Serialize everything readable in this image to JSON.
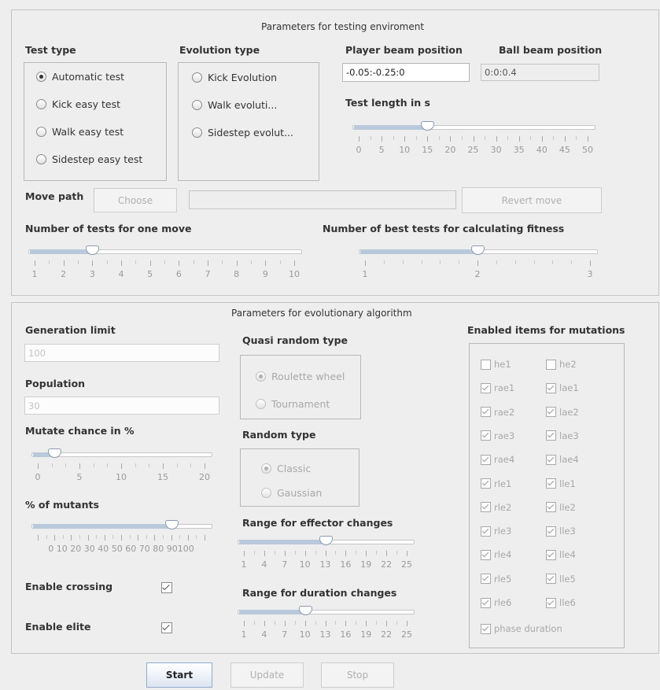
{
  "testing": {
    "title": "Parameters for testing enviroment",
    "test_type": {
      "label": "Test type",
      "options": [
        "Automatic test",
        "Kick easy test",
        "Walk easy test",
        "Sidestep easy test"
      ],
      "selected": "Automatic test"
    },
    "evolution_type": {
      "label": "Evolution type",
      "options": [
        "Kick Evolution",
        "Walk evoluti...",
        "Sidestep evolut..."
      ],
      "selected": ""
    },
    "player_beam": {
      "label": "Player beam position",
      "value": "-0.05:-0.25:0"
    },
    "ball_beam": {
      "label": "Ball beam position",
      "value": "0:0:0.4"
    },
    "test_length": {
      "label": "Test length in s",
      "value": 15,
      "min": 0,
      "max": 50,
      "ticks": [
        "0",
        "5",
        "10",
        "15",
        "20",
        "25",
        "30",
        "35",
        "40",
        "45",
        "50"
      ]
    },
    "move_path": {
      "label": "Move path",
      "choose_label": "Choose",
      "path_value": "",
      "revert_label": "Revert move"
    },
    "tests_per_move": {
      "label": "Number of tests for one move",
      "value": 3,
      "min": 1,
      "max": 10,
      "ticks": [
        "1",
        "2",
        "3",
        "4",
        "5",
        "6",
        "7",
        "8",
        "9",
        "10"
      ]
    },
    "best_tests": {
      "label": "Number of best tests for calculating fitness",
      "value": 2,
      "min": 1,
      "max": 3,
      "ticks": [
        "1",
        "2",
        "3"
      ]
    }
  },
  "evolution": {
    "title": "Parameters for evolutionary algorithm",
    "generation_limit": {
      "label": "Generation limit",
      "value": "100"
    },
    "population": {
      "label": "Population",
      "value": "30"
    },
    "mutate_chance": {
      "label": "Mutate chance in %",
      "value": 2,
      "min": 0,
      "max": 20,
      "ticks": [
        "0",
        "5",
        "10",
        "15",
        "20"
      ]
    },
    "pct_mutants": {
      "label": "% of mutants",
      "value": 80,
      "min": 0,
      "max": 100,
      "ticks_text": "0 10 20 30 40 50 60 70 80 90100"
    },
    "enable_crossing": {
      "label": "Enable crossing",
      "checked": true
    },
    "enable_elite": {
      "label": "Enable elite",
      "checked": true
    },
    "quasi_random": {
      "label": "Quasi random type",
      "options": [
        "Roulette wheel",
        "Tournament"
      ],
      "selected": "Roulette wheel"
    },
    "random_type": {
      "label": "Random type",
      "options": [
        "Classic",
        "Gaussian"
      ],
      "selected": "Classic"
    },
    "effector_range": {
      "label": "Range for effector changes",
      "value": 13,
      "min": 1,
      "max": 25,
      "ticks": [
        "1",
        "4",
        "7",
        "10",
        "13",
        "16",
        "19",
        "22",
        "25"
      ]
    },
    "duration_range": {
      "label": "Range for duration changes",
      "value": 10,
      "min": 1,
      "max": 25,
      "ticks": [
        "1",
        "4",
        "7",
        "10",
        "13",
        "16",
        "19",
        "22",
        "25"
      ]
    },
    "mutation_items": {
      "label": "Enabled items for mutations",
      "rows": [
        [
          {
            "name": "he1",
            "checked": false
          },
          {
            "name": "he2",
            "checked": false
          }
        ],
        [
          {
            "name": "rae1",
            "checked": true
          },
          {
            "name": "lae1",
            "checked": true
          }
        ],
        [
          {
            "name": "rae2",
            "checked": true
          },
          {
            "name": "lae2",
            "checked": true
          }
        ],
        [
          {
            "name": "rae3",
            "checked": true
          },
          {
            "name": "lae3",
            "checked": true
          }
        ],
        [
          {
            "name": "rae4",
            "checked": true
          },
          {
            "name": "lae4",
            "checked": true
          }
        ],
        [
          {
            "name": "rle1",
            "checked": true
          },
          {
            "name": "lle1",
            "checked": true
          }
        ],
        [
          {
            "name": "rle2",
            "checked": true
          },
          {
            "name": "lle2",
            "checked": true
          }
        ],
        [
          {
            "name": "rle3",
            "checked": true
          },
          {
            "name": "lle3",
            "checked": true
          }
        ],
        [
          {
            "name": "rle4",
            "checked": true
          },
          {
            "name": "lle4",
            "checked": true
          }
        ],
        [
          {
            "name": "rle5",
            "checked": true
          },
          {
            "name": "lle5",
            "checked": true
          }
        ],
        [
          {
            "name": "rle6",
            "checked": true
          },
          {
            "name": "lle6",
            "checked": true
          }
        ]
      ],
      "phase_duration": {
        "name": "phase duration",
        "checked": true
      }
    }
  },
  "footer": {
    "start_label": "Start",
    "update_label": "Update",
    "stop_label": "Stop"
  }
}
